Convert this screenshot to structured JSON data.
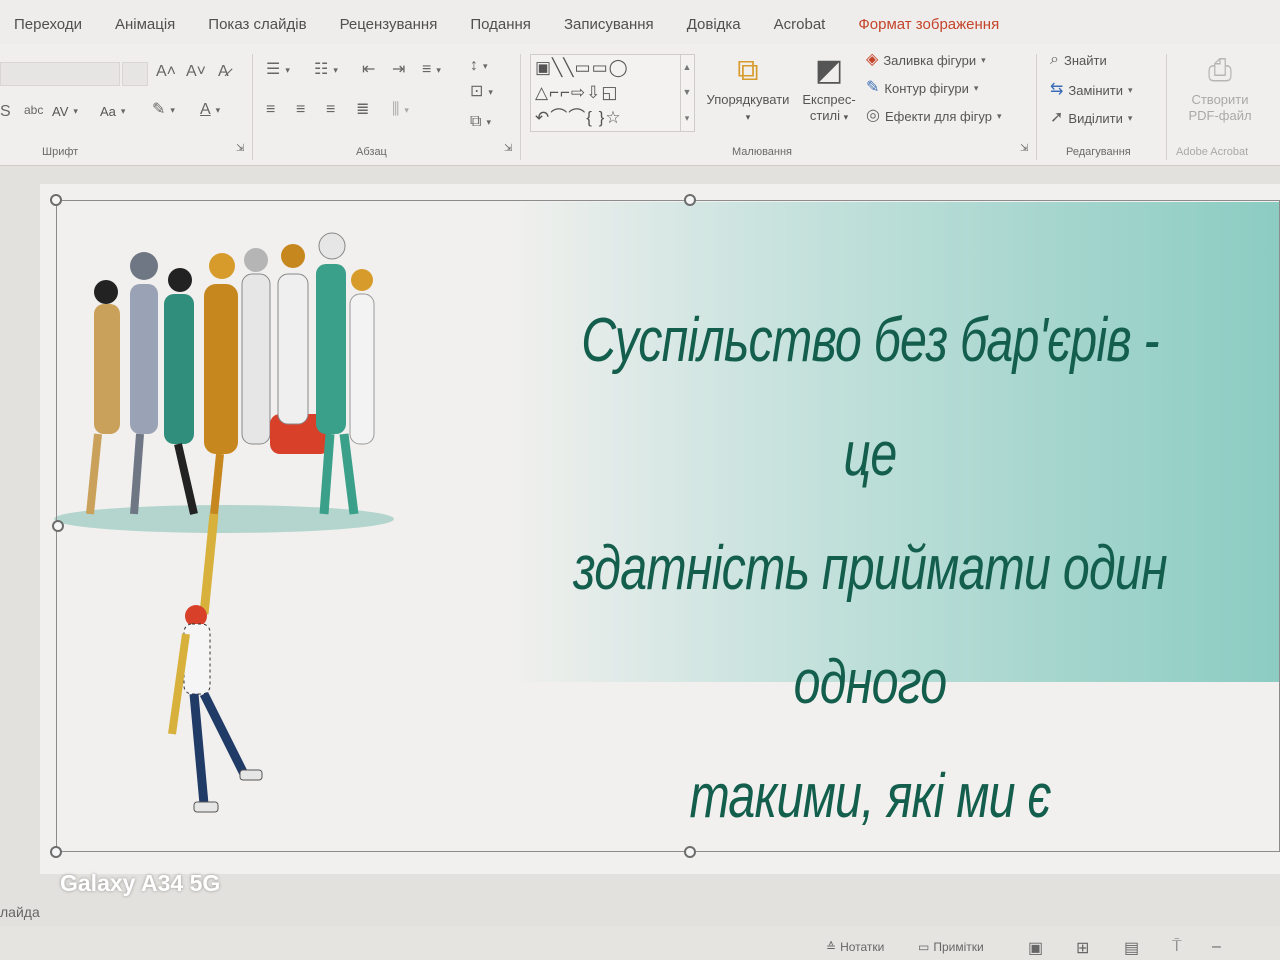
{
  "ribbon_tabs": [
    {
      "label": "Переходи",
      "active": false
    },
    {
      "label": "Анімація",
      "active": false
    },
    {
      "label": "Показ слайдів",
      "active": false
    },
    {
      "label": "Рецензування",
      "active": false
    },
    {
      "label": "Подання",
      "active": false
    },
    {
      "label": "Записування",
      "active": false
    },
    {
      "label": "Довідка",
      "active": false
    },
    {
      "label": "Acrobat",
      "active": false
    },
    {
      "label": "Формат зображення",
      "active": true
    }
  ],
  "groups": {
    "font": {
      "label": "Шрифт",
      "case_label": "Aa",
      "spacing_label": "AV"
    },
    "paragraph": {
      "label": "Абзац"
    },
    "drawing": {
      "label": "Малювання",
      "arrange_label": "Упорядкувати",
      "quick_styles_label_1": "Експрес-",
      "quick_styles_label_2": "стилі",
      "shape_fill": "Заливка фігури",
      "shape_outline": "Контур фігури",
      "shape_effects": "Ефекти для фігур"
    },
    "editing": {
      "label": "Редагування",
      "find": "Знайти",
      "replace": "Замінити",
      "select": "Виділити"
    },
    "acrobat": {
      "label": "Adobe Acrobat",
      "create_pdf_1": "Створити",
      "create_pdf_2": "PDF-файл"
    }
  },
  "slide": {
    "title_line1": "Суспільство без бар'єрів - це",
    "title_line2": "здатність приймати один одного",
    "title_line3": "такими, які ми є"
  },
  "watermark": "Galaxy A34 5G",
  "statusbar": {
    "left": "лайда",
    "notes": "Нотатки",
    "comments": "Примітки"
  },
  "colors": {
    "active_tab": "#c4442b",
    "title_text": "#135e4c",
    "banner": "#8cccc2"
  }
}
